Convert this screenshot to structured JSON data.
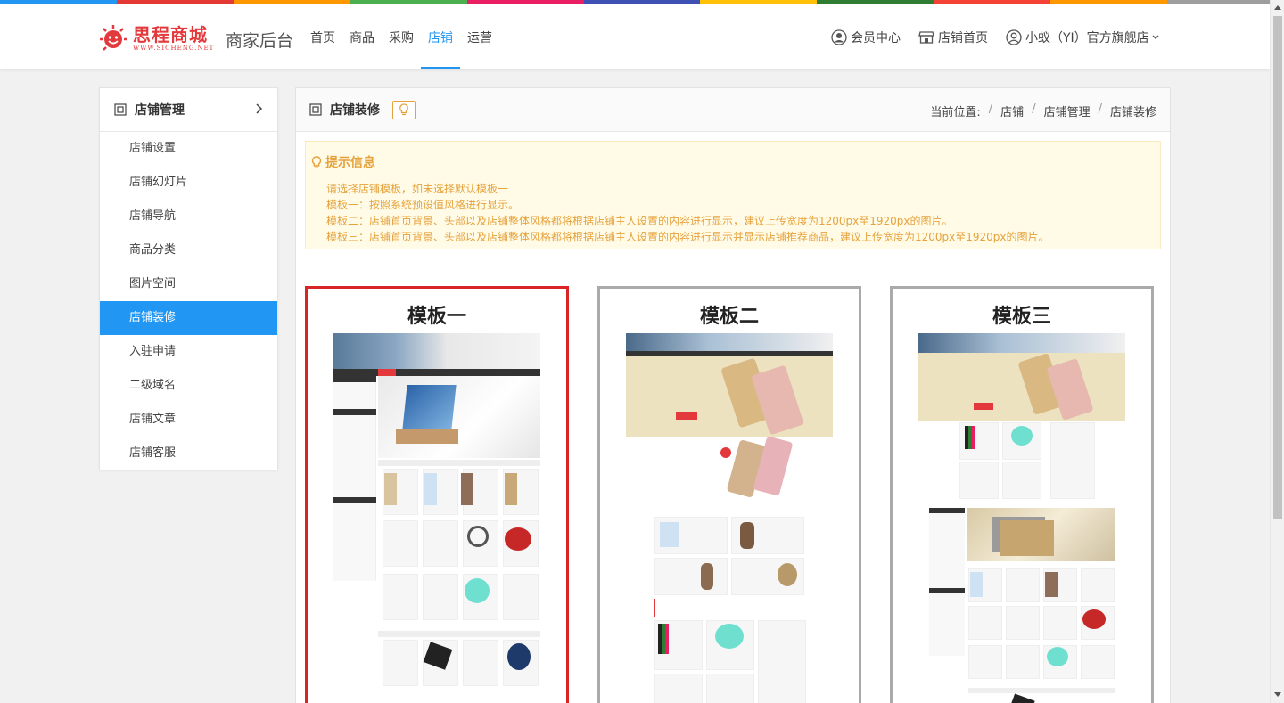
{
  "header": {
    "logo_text": "思程商城",
    "logo_sub": "WWW.SICHENG.NET",
    "biz_title": "商家后台",
    "nav": [
      {
        "label": "首页",
        "active": false
      },
      {
        "label": "商品",
        "active": false
      },
      {
        "label": "采购",
        "active": false
      },
      {
        "label": "店铺",
        "active": true
      },
      {
        "label": "运营",
        "active": false
      }
    ],
    "member_center": "会员中心",
    "shop_home": "店铺首页",
    "shop_name": "小蚁（YI）官方旗舰店"
  },
  "colors": {
    "accent": "#2196f3",
    "brand_red": "#e4393c",
    "tip_text": "#e6a23c",
    "tip_bg": "#fffbe6",
    "selected_border": "#d92525",
    "rainbow": [
      "#2196f3",
      "#e53935",
      "#ff9800",
      "#4caf50",
      "#e91e63",
      "#3f51b5",
      "#ffc107",
      "#2e7d32",
      "#f44336",
      "#ff9800",
      "#9e9e9e"
    ]
  },
  "sidebar": {
    "title": "店铺管理",
    "items": [
      {
        "label": "店铺设置",
        "active": false
      },
      {
        "label": "店铺幻灯片",
        "active": false
      },
      {
        "label": "店铺导航",
        "active": false
      },
      {
        "label": "商品分类",
        "active": false
      },
      {
        "label": "图片空间",
        "active": false
      },
      {
        "label": "店铺装修",
        "active": true
      },
      {
        "label": "入驻申请",
        "active": false
      },
      {
        "label": "二级域名",
        "active": false
      },
      {
        "label": "店铺文章",
        "active": false
      },
      {
        "label": "店铺客服",
        "active": false
      }
    ]
  },
  "content": {
    "title": "店铺装修",
    "breadcrumb": {
      "prefix": "当前位置:",
      "items": [
        "店铺",
        "店铺管理",
        "店铺装修"
      ]
    },
    "tip": {
      "title": "提示信息",
      "lines": [
        "请选择店铺模板，如未选择默认模板一",
        "模板一：按照系统预设值风格进行显示。",
        "模板二：店铺首页背景、头部以及店铺整体风格都将根据店铺主人设置的内容进行显示，建议上传宽度为1200px至1920px的图片。",
        "模板三：店铺首页背景、头部以及店铺整体风格都将根据店铺主人设置的内容进行显示并显示店铺推荐商品，建议上传宽度为1200px至1920px的图片。"
      ]
    },
    "templates": [
      {
        "title": "模板一",
        "selected": true
      },
      {
        "title": "模板二",
        "selected": false
      },
      {
        "title": "模板三",
        "selected": false
      }
    ]
  }
}
